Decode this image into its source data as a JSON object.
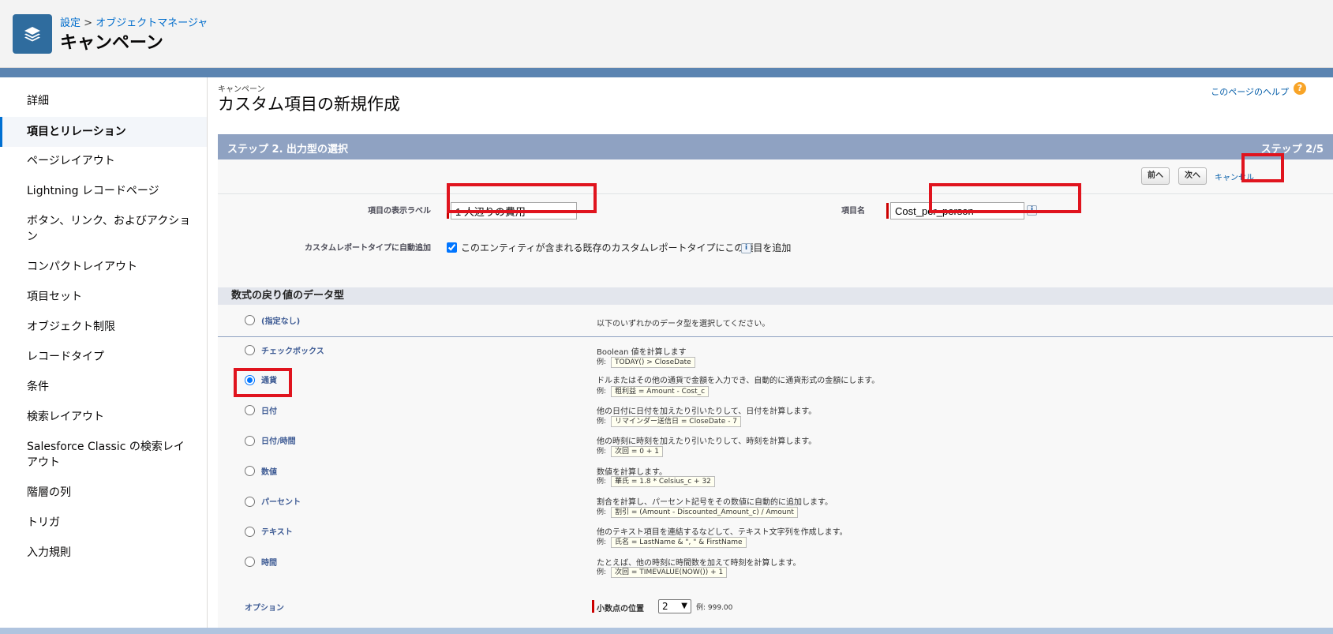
{
  "header": {
    "crumb_setup": "設定",
    "crumb_sep": ">",
    "crumb_object_manager": "オブジェクトマネージャ",
    "title": "キャンペーン",
    "icon": "layers-icon"
  },
  "sidebar": {
    "items": [
      {
        "label": "詳細"
      },
      {
        "label": "項目とリレーション"
      },
      {
        "label": "ページレイアウト"
      },
      {
        "label": "Lightning レコードページ"
      },
      {
        "label": "ボタン、リンク、およびアクション"
      },
      {
        "label": "コンパクトレイアウト"
      },
      {
        "label": "項目セット"
      },
      {
        "label": "オブジェクト制限"
      },
      {
        "label": "レコードタイプ"
      },
      {
        "label": "条件"
      },
      {
        "label": "検索レイアウト"
      },
      {
        "label": "Salesforce Classic の検索レイアウト"
      },
      {
        "label": "階層の列"
      },
      {
        "label": "トリガ"
      },
      {
        "label": "入力規則"
      }
    ],
    "active_index": 1
  },
  "main": {
    "context": "キャンペーン",
    "page_title": "カスタム項目の新規作成",
    "help_link": "このページのヘルプ",
    "help_icon": "?",
    "step_title": "ステップ 2. 出力型の選択",
    "step_count": "ステップ 2/5",
    "buttons": {
      "prev": "前へ",
      "next": "次へ",
      "cancel": "キャンセル"
    },
    "form": {
      "label_label": "項目の表示ラベル",
      "label_value": "1 人辺りの費用",
      "name_label": "項目名",
      "name_value": "Cost_per_person",
      "auto_add_label": "カスタムレポートタイプに自動追加",
      "auto_add_text": "このエンティティが含まれる既存のカスタムレポートタイプにこの項目を追加",
      "info_icon": "i"
    },
    "section_title": "数式の戻り値のデータ型",
    "none_option": {
      "label": "(指定なし)",
      "desc": "以下のいずれかのデータ型を選択してください。"
    },
    "example_prefix": "例:",
    "types": [
      {
        "label": "チェックボックス",
        "desc": "Boolean 値を計算します",
        "example": "TODAY() > CloseDate"
      },
      {
        "label": "通貨",
        "desc": "ドルまたはその他の通貨で金額を入力でき、自動的に通貨形式の金額にします。",
        "example": "粗利益 = Amount - Cost_c"
      },
      {
        "label": "日付",
        "desc": "他の日付に日付を加えたり引いたりして、日付を計算します。",
        "example": "リマインダー送信日 = CloseDate - 7"
      },
      {
        "label": "日付/時間",
        "desc": "他の時刻に時刻を加えたり引いたりして、時刻を計算します。",
        "example": "次回 = 0 + 1"
      },
      {
        "label": "数値",
        "desc": "数値を計算します。",
        "example": "華氏 = 1.8 * Celsius_c + 32"
      },
      {
        "label": "パーセント",
        "desc": "割合を計算し、パーセント記号をその数値に自動的に追加します。",
        "example": "割引 = (Amount - Discounted_Amount_c) / Amount"
      },
      {
        "label": "テキスト",
        "desc": "他のテキスト項目を連結するなどして、テキスト文字列を作成します。",
        "example": "氏名 = LastName & \", \" & FirstName"
      },
      {
        "label": "時間",
        "desc": "たとえば、他の時刻に時間数を加えて時刻を計算します。",
        "example": "次回 = TIMEVALUE(NOW()) + 1"
      }
    ],
    "selected_type_index": 1,
    "options": {
      "label": "オプション",
      "decimal_label": "小数点の位置",
      "decimal_value": "2",
      "decimal_example": "例: 999.00"
    }
  },
  "colors": {
    "highlight": "#e0141e",
    "step_bar": "#8fa2c2",
    "link": "#015ba7"
  }
}
